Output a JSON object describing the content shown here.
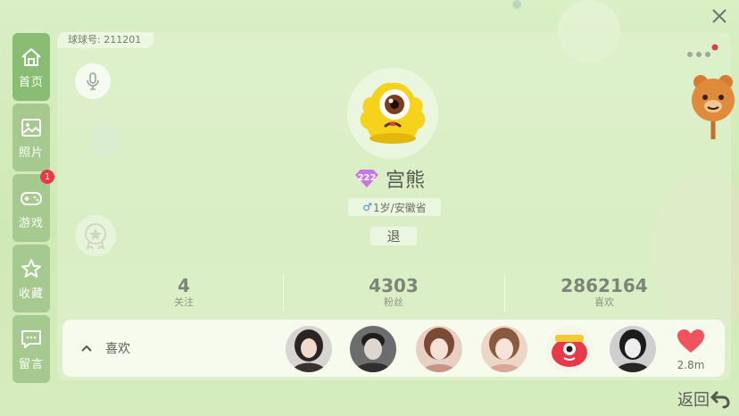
{
  "sidebar": {
    "items": [
      {
        "label": "首页",
        "icon": "home-icon",
        "active": true
      },
      {
        "label": "照片",
        "icon": "photo-icon"
      },
      {
        "label": "游戏",
        "icon": "gamepad-icon",
        "badge": "1"
      },
      {
        "label": "收藏",
        "icon": "star-icon"
      },
      {
        "label": "留言",
        "icon": "message-icon"
      }
    ]
  },
  "profile": {
    "uid_label": "球球号: 211201",
    "level": "222",
    "nickname": "宫熊",
    "gender_symbol": "♂",
    "age_region": "1岁/安徽省",
    "exit_label": "退"
  },
  "stats": [
    {
      "value": "4",
      "label": "关注"
    },
    {
      "value": "4303",
      "label": "粉丝"
    },
    {
      "value": "2862164",
      "label": "喜欢"
    }
  ],
  "likes": {
    "label": "喜欢",
    "fans": [
      "fan-avatar-1",
      "fan-avatar-2",
      "fan-avatar-3",
      "fan-avatar-4",
      "fan-avatar-5",
      "fan-avatar-6"
    ],
    "heart_count": "2.8m"
  },
  "back_label": "返回",
  "colors": {
    "accent": "#88bd73",
    "badge": "#e8394b",
    "heart": "#f0525e",
    "avatar_yellow": "#f7d21b"
  }
}
